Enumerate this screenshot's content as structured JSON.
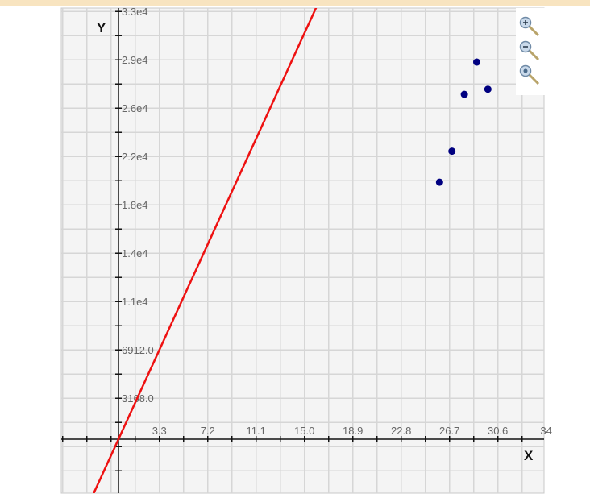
{
  "chart_data": {
    "type": "scatter",
    "title": "",
    "xlabel": "X",
    "ylabel": "Y",
    "xlim": [
      -4.6,
      34.4
    ],
    "ylim": [
      -4200,
      33700
    ],
    "grid": true,
    "x_ticks": [
      "3.3",
      "7.2",
      "11.1",
      "15.0",
      "18.9",
      "22.8",
      "26.7",
      "30.6",
      "34"
    ],
    "x_tick_values": [
      3.3,
      7.2,
      11.1,
      15.0,
      18.9,
      22.8,
      26.7,
      30.6,
      34.5
    ],
    "y_ticks": [
      "3168.0",
      "6912.0",
      "1.1e4",
      "1.4e4",
      "1.8e4",
      "2.2e4",
      "2.6e4",
      "2.9e4",
      "3.3e4"
    ],
    "y_tick_values": [
      3168,
      6912,
      10656,
      14400,
      18144,
      21888,
      25632,
      29376,
      33120
    ],
    "points": [
      {
        "x": 25.9,
        "y": 19900
      },
      {
        "x": 26.9,
        "y": 22300
      },
      {
        "x": 27.9,
        "y": 26700
      },
      {
        "x": 28.9,
        "y": 29200
      },
      {
        "x": 29.8,
        "y": 27100
      }
    ],
    "line": {
      "slope": 2096,
      "intercept": 0
    },
    "colors": {
      "points": "#000080",
      "line": "#ee1111",
      "grid": "#d6d6d6",
      "background": "#f4f4f4"
    }
  },
  "toolbar": {
    "icons": [
      "zoom-in-icon",
      "zoom-out-icon",
      "zoom-reset-icon"
    ]
  }
}
